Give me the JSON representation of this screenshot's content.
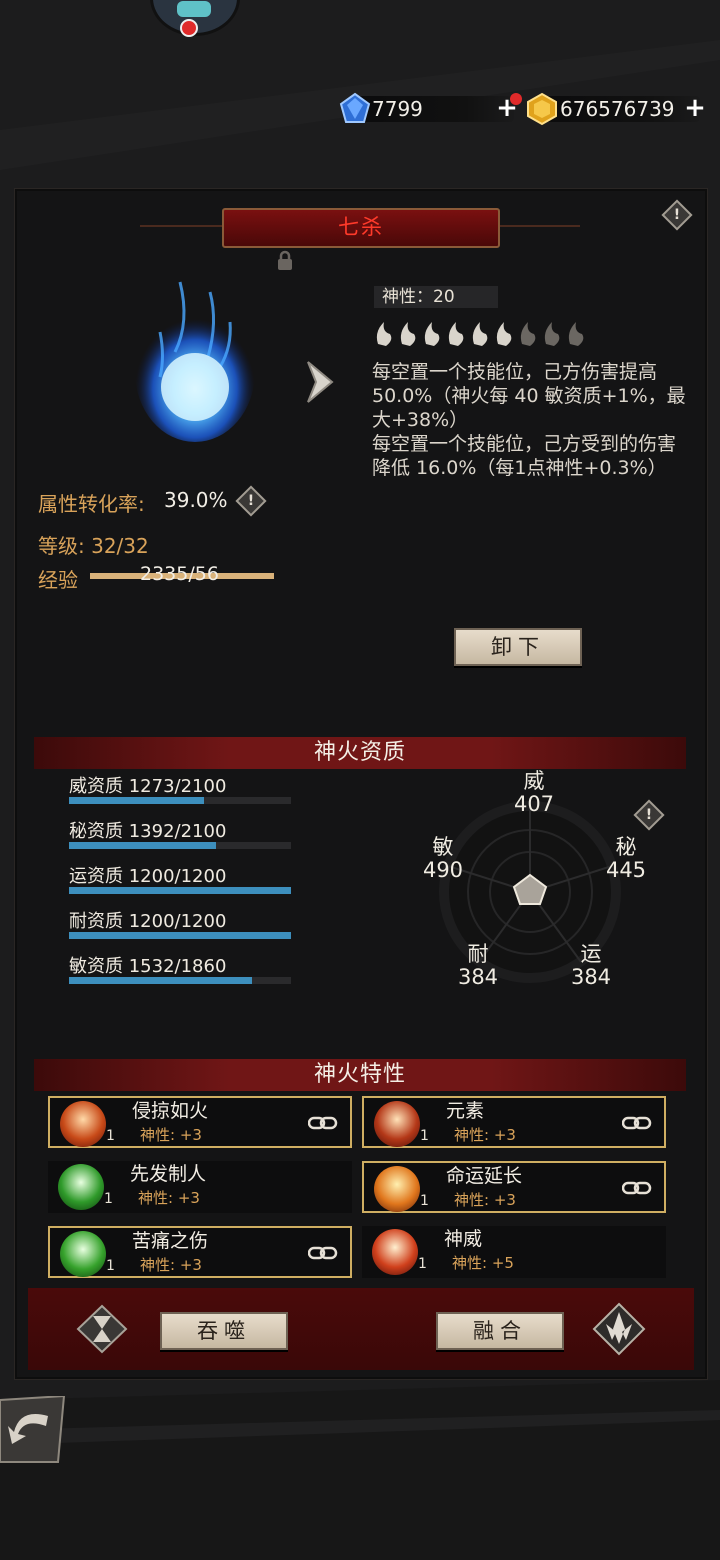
{
  "currency": {
    "gems": "7799",
    "gold": "676576739"
  },
  "panel": {
    "title": "七杀"
  },
  "info": {
    "divinity": "神性：20",
    "description_1": "每空置一个技能位，己方伤害提高50.0%（神火每 40 敏资质+1%，最大+38%）",
    "description_2": "每空置一个技能位，己方受到的伤害降低 16.0%（每1点神性+0.3%）"
  },
  "stats": {
    "conversion_label": "属性转化率:",
    "conversion_value": "39.0%",
    "level_label": "等级: 32/32",
    "exp_label": "经验",
    "exp_value": "2335/56",
    "exp_progress": 1.0
  },
  "buttons": {
    "unequip": "卸下",
    "devour": "吞噬",
    "fuse": "融合"
  },
  "aptitude": {
    "section_title": "神火资质",
    "bars": [
      {
        "label": "威资质 1273/2100",
        "fraction": 0.606
      },
      {
        "label": "秘资质 1392/2100",
        "fraction": 0.663
      },
      {
        "label": "运资质 1200/1200",
        "fraction": 1.0
      },
      {
        "label": "耐资质 1200/1200",
        "fraction": 1.0
      },
      {
        "label": "敏资质 1532/1860",
        "fraction": 0.824
      }
    ],
    "radar": {
      "wei": {
        "name": "威",
        "value": "407"
      },
      "mi": {
        "name": "秘",
        "value": "445"
      },
      "yun": {
        "name": "运",
        "value": "384"
      },
      "nai": {
        "name": "耐",
        "value": "384"
      },
      "min": {
        "name": "敏",
        "value": "490"
      }
    }
  },
  "traits": {
    "section_title": "神火特性",
    "items": [
      {
        "name": "侵掠如火",
        "value": "神性: +3",
        "level": "1",
        "linked": true
      },
      {
        "name": "元素",
        "value": "神性: +3",
        "level": "1",
        "linked": true
      },
      {
        "name": "先发制人",
        "value": "神性: +3",
        "level": "1",
        "linked": false
      },
      {
        "name": "命运延长",
        "value": "神性: +3",
        "level": "1",
        "linked": true
      },
      {
        "name": "苦痛之伤",
        "value": "神性: +3",
        "level": "1",
        "linked": true
      },
      {
        "name": "神威",
        "value": "神性: +5",
        "level": "1",
        "linked": false
      }
    ]
  },
  "colors": {
    "accent_red": "#701616",
    "gold_text": "#d9a35a",
    "aptitude_bar": "#3d8fbd"
  }
}
